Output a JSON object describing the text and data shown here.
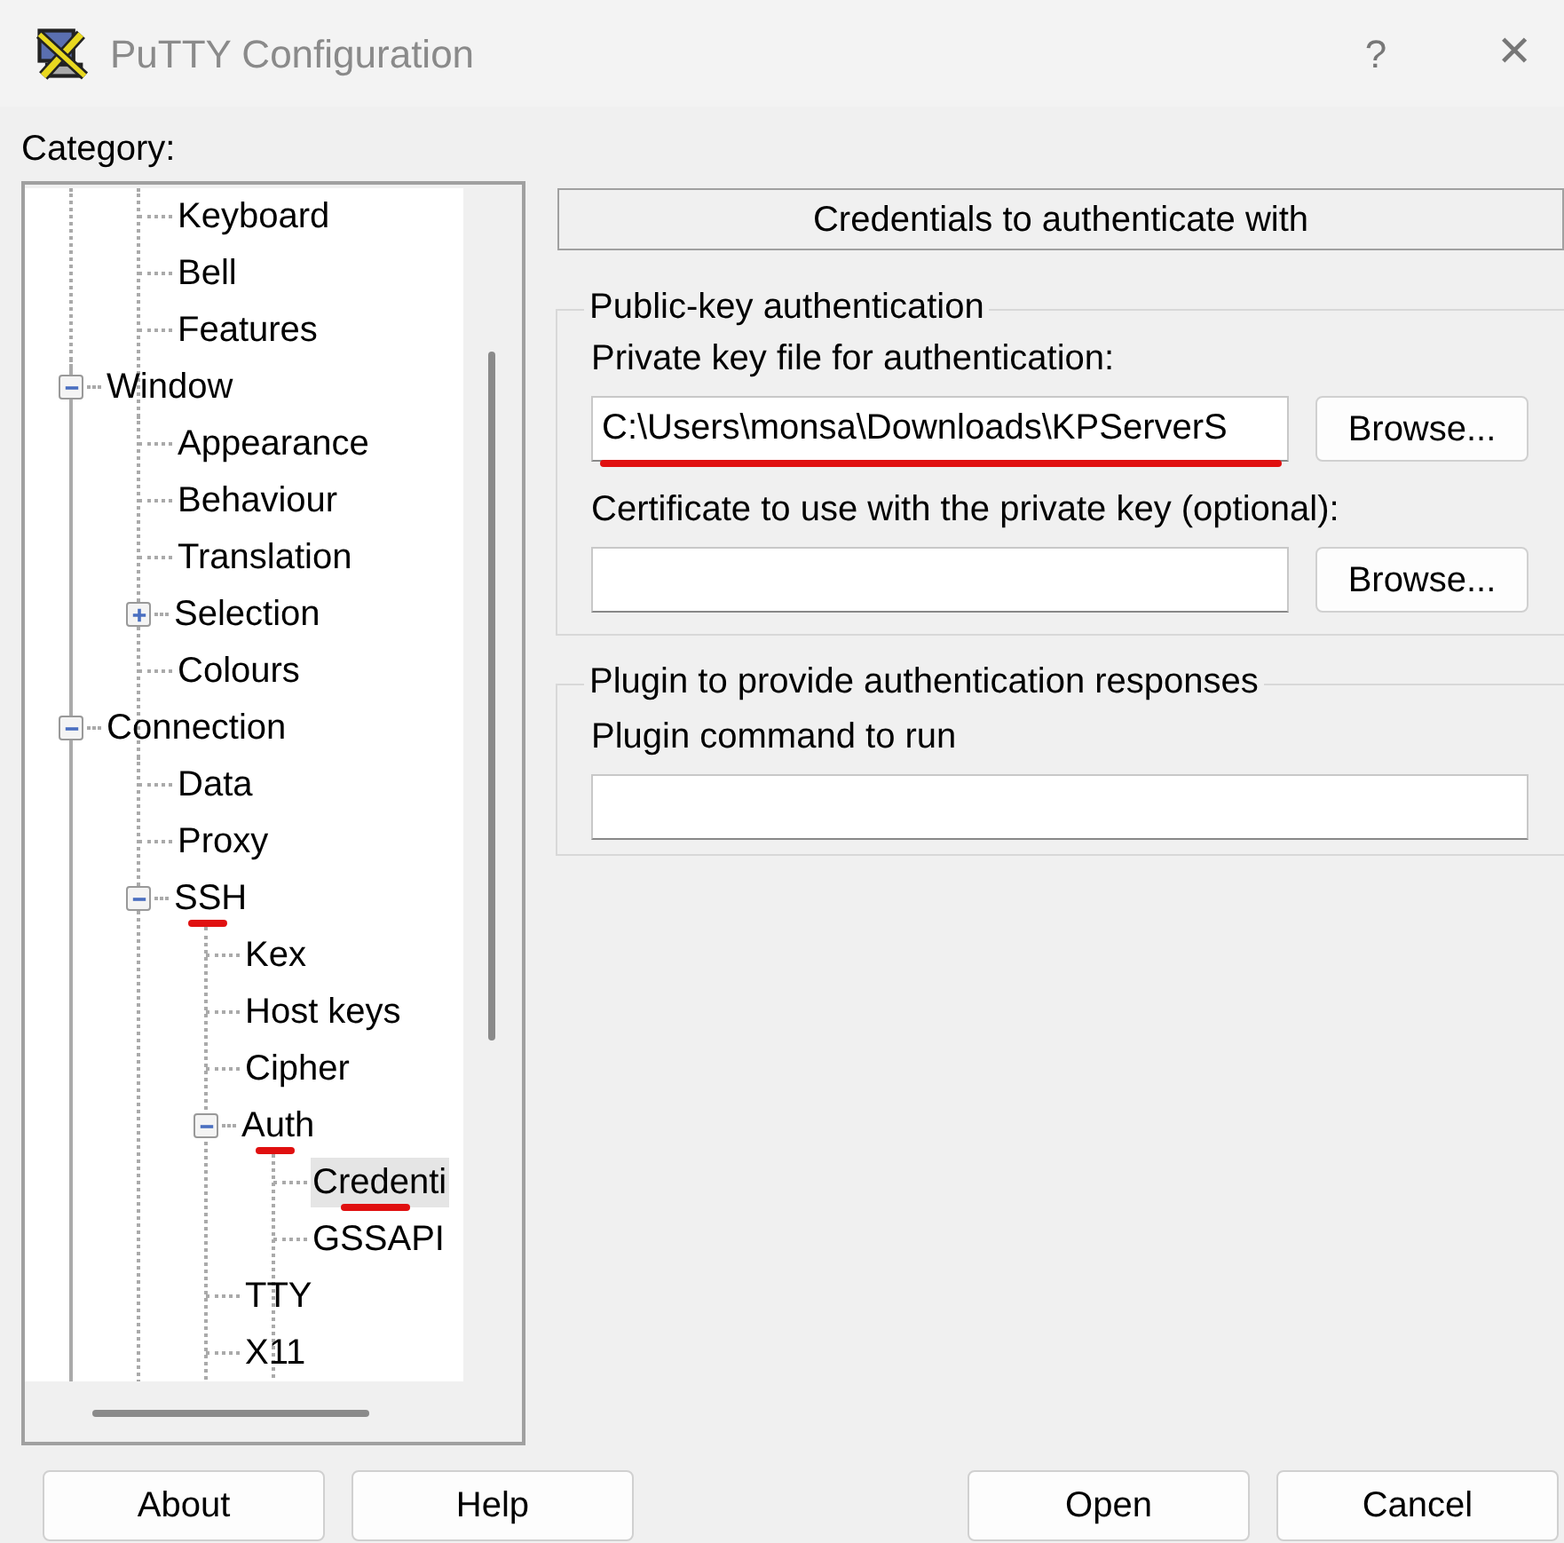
{
  "window": {
    "title": "PuTTY Configuration",
    "help_glyph": "?",
    "close_glyph": "✕"
  },
  "category_label": "Category:",
  "tree": {
    "partial_branch": [
      {
        "label": "Keyboard",
        "selected": false,
        "underlined": false
      },
      {
        "label": "Bell",
        "selected": false,
        "underlined": false
      },
      {
        "label": "Features",
        "selected": false,
        "underlined": false
      }
    ],
    "items": [
      {
        "label": "Window",
        "selected": false,
        "underlined": false,
        "expanded": true,
        "children": [
          {
            "label": "Appearance",
            "selected": false,
            "underlined": false
          },
          {
            "label": "Behaviour",
            "selected": false,
            "underlined": false
          },
          {
            "label": "Translation",
            "selected": false,
            "underlined": false
          },
          {
            "label": "Selection",
            "selected": false,
            "underlined": false,
            "expanded": false
          },
          {
            "label": "Colours",
            "selected": false,
            "underlined": false
          }
        ]
      },
      {
        "label": "Connection",
        "selected": false,
        "underlined": false,
        "expanded": true,
        "children": [
          {
            "label": "Data",
            "selected": false,
            "underlined": false
          },
          {
            "label": "Proxy",
            "selected": false,
            "underlined": false
          },
          {
            "label": "SSH",
            "selected": false,
            "underlined": true,
            "expanded": true,
            "children": [
              {
                "label": "Kex",
                "selected": false,
                "underlined": false
              },
              {
                "label": "Host keys",
                "selected": false,
                "underlined": false
              },
              {
                "label": "Cipher",
                "selected": false,
                "underlined": false
              },
              {
                "label": "Auth",
                "selected": false,
                "underlined": true,
                "expanded": true,
                "children": [
                  {
                    "label": "Credenti",
                    "selected": true,
                    "underlined": true
                  },
                  {
                    "label": "GSSAPI",
                    "selected": false,
                    "underlined": false
                  }
                ]
              },
              {
                "label": "TTY",
                "selected": false,
                "underlined": false
              },
              {
                "label": "X11",
                "selected": false,
                "underlined": false
              }
            ]
          }
        ]
      }
    ]
  },
  "panel": {
    "header": "Credentials to authenticate with",
    "groups": [
      {
        "legend": "Public-key authentication",
        "fields": [
          {
            "label": "Private key file for authentication:",
            "value": "C:\\Users\\monsa\\Downloads\\KPServerS",
            "button": "Browse...",
            "underlined": true
          },
          {
            "label": "Certificate to use with the private key (optional):",
            "button": "Browse...",
            "underlined": false
          }
        ]
      },
      {
        "legend": "Plugin to provide authentication responses",
        "fields": [
          {
            "label": "Plugin command to run",
            "underlined": false
          }
        ]
      }
    ]
  },
  "buttons": {
    "left": [
      "About",
      "Help"
    ],
    "right": [
      "Open",
      "Cancel"
    ]
  }
}
